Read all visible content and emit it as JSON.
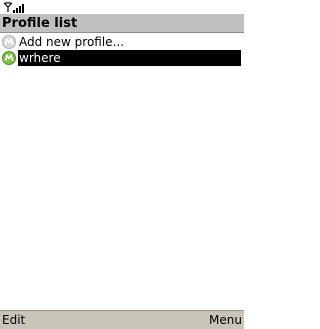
{
  "status": {
    "antenna_icon": "antenna-icon",
    "signal_icon": "signal-strength-icon"
  },
  "title": "Profile list",
  "items": [
    {
      "label": "Add new profile...",
      "icon": "profile-icon-gray",
      "selected": false
    },
    {
      "label": "wrhere",
      "icon": "profile-icon-green",
      "selected": true
    }
  ],
  "softkeys": {
    "left": "Edit",
    "right": "Menu"
  },
  "colors": {
    "title_bar": "#c0c0c0",
    "softkey_bar": "#c8c4b8",
    "selection": "#000000",
    "icon_green": "#7cc242",
    "icon_gray": "#c8c8c8"
  }
}
